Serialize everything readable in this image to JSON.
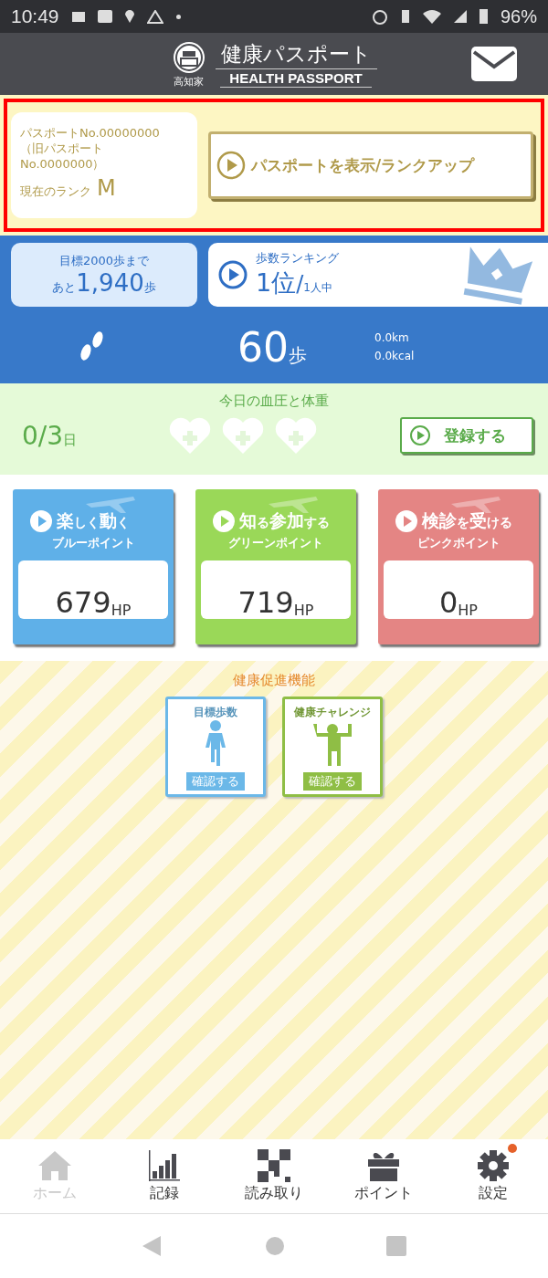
{
  "status_bar": {
    "time": "10:49",
    "battery": "96%"
  },
  "header": {
    "logo_caption": "高知家",
    "title": "健康パスポート",
    "subtitle": "HEALTH PASSPORT"
  },
  "passport": {
    "highlighted": true,
    "number": "パスポートNo.00000000",
    "old_number": "（旧パスポート No.0000000）",
    "rank_label": "現在のランク",
    "rank": "M",
    "button": "パスポートを表示/ランクアップ"
  },
  "goal": {
    "label": "目標2000歩まで",
    "prefix": "あと",
    "value": "1,940",
    "unit": "歩"
  },
  "ranking": {
    "label": "歩数ランキング",
    "value": "1位",
    "slash": "/",
    "total": "1人中"
  },
  "steps": {
    "value": "60",
    "unit": "歩",
    "distance": "0.0km",
    "calories": "0.0kcal"
  },
  "vitals": {
    "title": "今日の血圧と体重",
    "count": "0/3",
    "unit": "日",
    "hearts": [
      {
        "filled": false
      },
      {
        "filled": false
      },
      {
        "filled": false
      }
    ],
    "button": "登録する"
  },
  "point_cards": [
    {
      "title_big1": "楽",
      "title_small1": "しく",
      "title_big2": "動",
      "title_small2": "く",
      "subtitle": "ブルーポイント",
      "value": "679",
      "unit": "HP",
      "color": "#5fb0e8"
    },
    {
      "title_big1": "知",
      "title_small1": "る",
      "title_big2": "参加",
      "title_small2": "する",
      "subtitle": "グリーンポイント",
      "value": "719",
      "unit": "HP",
      "color": "#9ad858"
    },
    {
      "title_big1": "検診",
      "title_small1": "を",
      "title_big2": "受",
      "title_small2": "ける",
      "subtitle": "ピンクポイント",
      "value": "0",
      "unit": "HP",
      "color": "#e48584"
    }
  ],
  "features": {
    "title": "健康促進機能",
    "tiles": [
      {
        "kind": "walking",
        "caption": "目標歩数",
        "button": "確認する",
        "color": "#6bb8e8"
      },
      {
        "kind": "cheering",
        "caption": "健康チャレンジ",
        "button": "確認する",
        "color": "#8fbe45"
      }
    ]
  },
  "bottom_nav": [
    {
      "kind": "home",
      "label": "ホーム",
      "selected": true,
      "badge": false
    },
    {
      "kind": "chart",
      "label": "記録",
      "selected": false,
      "badge": false
    },
    {
      "kind": "qr",
      "label": "読み取り",
      "selected": false,
      "badge": false
    },
    {
      "kind": "gift",
      "label": "ポイント",
      "selected": false,
      "badge": false
    },
    {
      "kind": "gear",
      "label": "設定",
      "selected": false,
      "badge": true
    }
  ]
}
